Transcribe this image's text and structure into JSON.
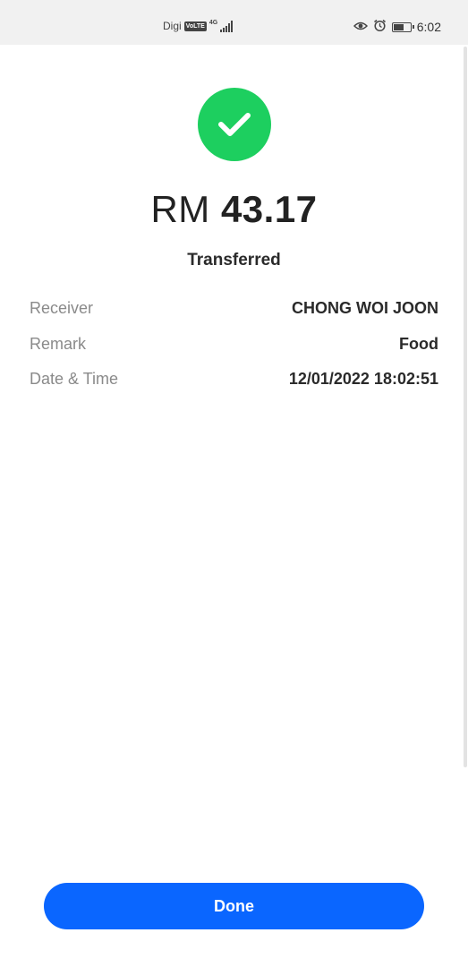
{
  "status_bar": {
    "carrier": "Digi",
    "volte": "VoLTE",
    "network": "4G",
    "battery_level": 0.55,
    "time": "6:02",
    "icons": [
      "eye-icon",
      "alarm-icon",
      "battery-icon",
      "signal-icon"
    ]
  },
  "transaction": {
    "currency": "RM",
    "amount": "43.17",
    "status": "Transferred",
    "details": [
      {
        "label": "Receiver",
        "value": "CHONG WOI JOON"
      },
      {
        "label": "Remark",
        "value": "Food"
      },
      {
        "label": "Date & Time",
        "value": "12/01/2022 18:02:51"
      }
    ]
  },
  "actions": {
    "done_label": "Done"
  },
  "colors": {
    "success": "#1dcf5f",
    "primary": "#0a66ff",
    "label": "#8a8a8a",
    "value": "#2a2a2a"
  }
}
